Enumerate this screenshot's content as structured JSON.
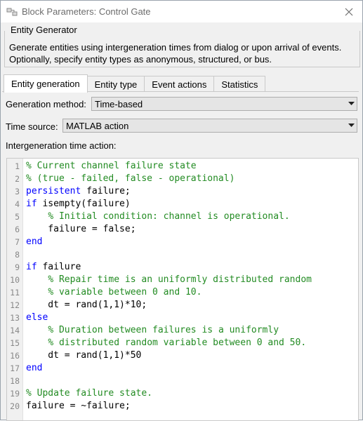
{
  "window": {
    "title": "Block Parameters: Control Gate",
    "icon": "simulink-block-icon",
    "close_icon": "close-icon"
  },
  "group": {
    "label": "Entity Generator",
    "description": "Generate entities using intergeneration times from dialog or upon arrival of events. Optionally, specify entity types as anonymous, structured, or bus."
  },
  "tabs": [
    {
      "label": "Entity generation",
      "active": true
    },
    {
      "label": "Entity type",
      "active": false
    },
    {
      "label": "Event actions",
      "active": false
    },
    {
      "label": "Statistics",
      "active": false
    }
  ],
  "form": {
    "generation_method_label": "Generation method:",
    "generation_method_value": "Time-based",
    "time_source_label": "Time source:",
    "time_source_value": "MATLAB action",
    "intergeneration_label": "Intergeneration time action:"
  },
  "code_lines": [
    {
      "n": "1",
      "segs": [
        {
          "c": "c",
          "t": "% Current channel failure state"
        }
      ]
    },
    {
      "n": "2",
      "segs": [
        {
          "c": "c",
          "t": "% (true - failed, false - operational)"
        }
      ]
    },
    {
      "n": "3",
      "segs": [
        {
          "c": "k",
          "t": "persistent"
        },
        {
          "c": "t",
          "t": " failure;"
        }
      ]
    },
    {
      "n": "4",
      "segs": [
        {
          "c": "k",
          "t": "if"
        },
        {
          "c": "t",
          "t": " isempty(failure)"
        }
      ]
    },
    {
      "n": "5",
      "segs": [
        {
          "c": "t",
          "t": "    "
        },
        {
          "c": "c",
          "t": "% Initial condition: channel is operational."
        }
      ]
    },
    {
      "n": "6",
      "segs": [
        {
          "c": "t",
          "t": "    failure = false;"
        }
      ]
    },
    {
      "n": "7",
      "segs": [
        {
          "c": "k",
          "t": "end"
        }
      ]
    },
    {
      "n": "8",
      "segs": []
    },
    {
      "n": "9",
      "segs": [
        {
          "c": "k",
          "t": "if"
        },
        {
          "c": "t",
          "t": " failure"
        }
      ]
    },
    {
      "n": "10",
      "segs": [
        {
          "c": "t",
          "t": "    "
        },
        {
          "c": "c",
          "t": "% Repair time is an uniformly distributed random"
        }
      ]
    },
    {
      "n": "11",
      "segs": [
        {
          "c": "t",
          "t": "    "
        },
        {
          "c": "c",
          "t": "% variable between 0 and 10."
        }
      ]
    },
    {
      "n": "12",
      "segs": [
        {
          "c": "t",
          "t": "    dt = rand(1,1)*10;"
        }
      ]
    },
    {
      "n": "13",
      "segs": [
        {
          "c": "k",
          "t": "else"
        }
      ]
    },
    {
      "n": "14",
      "segs": [
        {
          "c": "t",
          "t": "    "
        },
        {
          "c": "c",
          "t": "% Duration between failures is a uniformly"
        }
      ]
    },
    {
      "n": "15",
      "segs": [
        {
          "c": "t",
          "t": "    "
        },
        {
          "c": "c",
          "t": "% distributed random variable between 0 and 50."
        }
      ]
    },
    {
      "n": "16",
      "segs": [
        {
          "c": "t",
          "t": "    dt = rand(1,1)*50"
        }
      ]
    },
    {
      "n": "17",
      "segs": [
        {
          "c": "k",
          "t": "end"
        }
      ]
    },
    {
      "n": "18",
      "segs": []
    },
    {
      "n": "19",
      "segs": [
        {
          "c": "c",
          "t": "% Update failure state."
        }
      ]
    },
    {
      "n": "20",
      "segs": [
        {
          "c": "t",
          "t": "failure = ~failure;"
        }
      ]
    }
  ],
  "colors": {
    "comment": "#228b22",
    "keyword": "#0000ff",
    "window_bg": "#f0f0f0"
  }
}
